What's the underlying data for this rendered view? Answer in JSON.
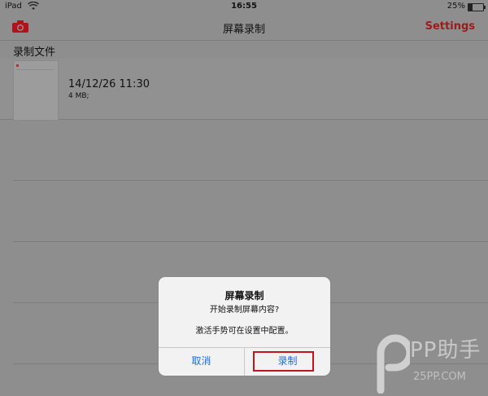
{
  "status_bar": {
    "carrier": "iPad",
    "time": "16:55",
    "battery_percent": "25%",
    "battery_level": 0.25
  },
  "navbar": {
    "title": "屏幕录制",
    "settings_label": "Settings",
    "camera_icon": "camera-icon",
    "accent_color": "#9e1b1b"
  },
  "section_header": "录制文件",
  "files": [
    {
      "date": "14/12/26 11:30",
      "size": "4 MB;"
    }
  ],
  "alert": {
    "title": "屏幕录制",
    "message_line1": "开始录制屏幕内容?",
    "message_line2": "激活手势可在设置中配置。",
    "cancel_label": "取消",
    "record_label": "录制",
    "button_color": "#1a6fe0",
    "highlight_color": "#c3151c"
  },
  "watermark": {
    "brand": "PP助手",
    "site": "25PP.COM"
  }
}
